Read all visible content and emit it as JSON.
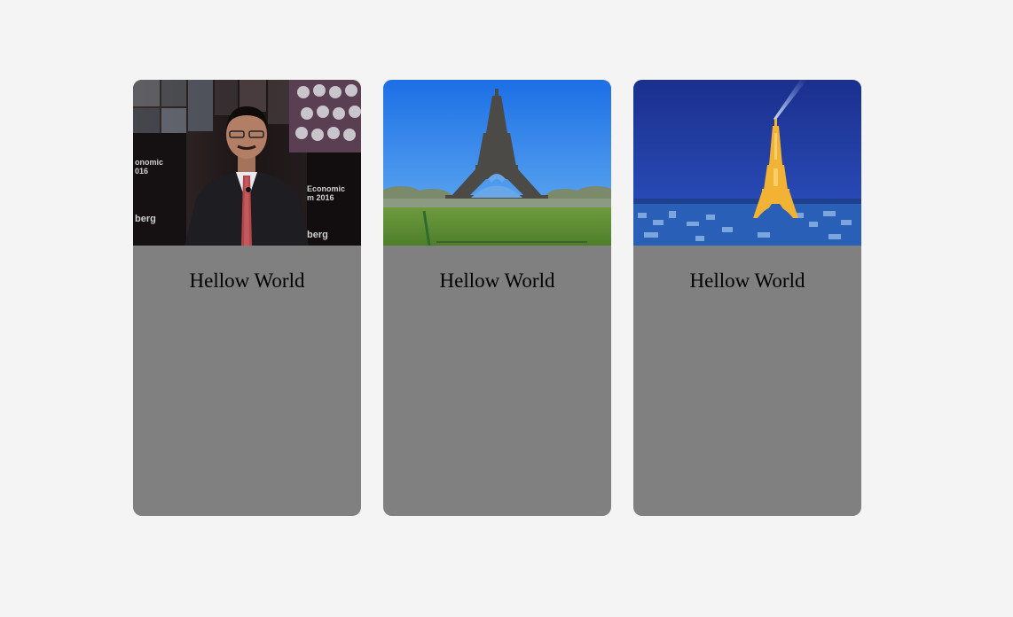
{
  "colors": {
    "page_background": "#f4f4f4",
    "card_background": "#808080",
    "text": "#000000"
  },
  "cards": [
    {
      "title": "Hellow World",
      "image": "man-in-suit-photo"
    },
    {
      "title": "Hellow World",
      "image": "eiffel-tower-day-photo"
    },
    {
      "title": "Hellow World",
      "image": "eiffel-tower-night-photo"
    }
  ]
}
